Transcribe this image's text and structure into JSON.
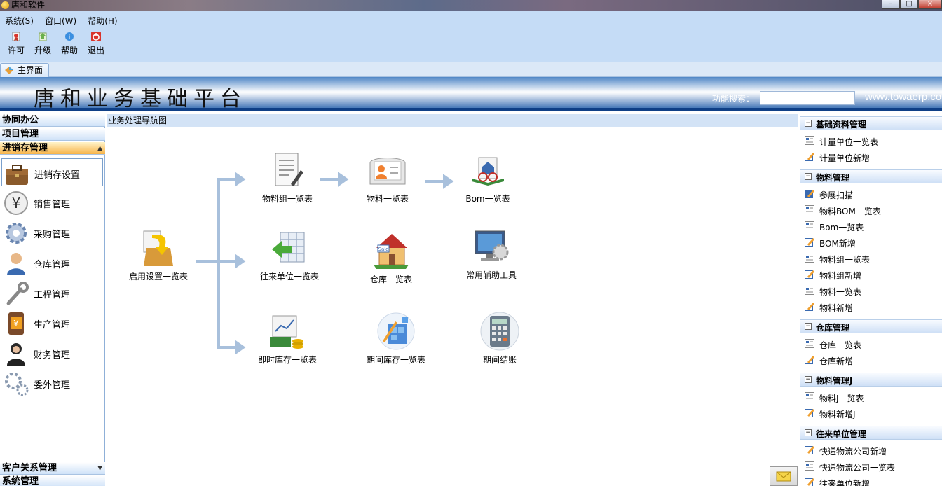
{
  "window": {
    "title": "唐和软件",
    "controls": [
      "–",
      "□",
      "×"
    ]
  },
  "menu": [
    "系统(S)",
    "窗口(W)",
    "帮助(H)"
  ],
  "toolbar": [
    {
      "label": "许可",
      "icon": "license-icon"
    },
    {
      "label": "升级",
      "icon": "upgrade-icon"
    },
    {
      "label": "帮助",
      "icon": "help-icon"
    },
    {
      "label": "退出",
      "icon": "exit-icon"
    }
  ],
  "tabs": [
    {
      "label": "主界面"
    }
  ],
  "banner": {
    "title": "唐和业务基础平台",
    "search_label": "功能搜索：",
    "search_value": "",
    "site": "www.towaerp.com"
  },
  "sidebar": {
    "top_groups": [
      "协同办公",
      "项目管理",
      "进销存管理"
    ],
    "items": [
      {
        "label": "进销存设置",
        "icon": "briefcase-icon"
      },
      {
        "label": "销售管理",
        "icon": "yen-coin-icon"
      },
      {
        "label": "采购管理",
        "icon": "gear-icon"
      },
      {
        "label": "仓库管理",
        "icon": "user-icon"
      },
      {
        "label": "工程管理",
        "icon": "wrench-icon"
      },
      {
        "label": "生产管理",
        "icon": "phone-yen-icon"
      },
      {
        "label": "财务管理",
        "icon": "woman-icon"
      },
      {
        "label": "委外管理",
        "icon": "gears-icon"
      }
    ],
    "bottom_groups": [
      "客户关系管理",
      "系统管理"
    ]
  },
  "nav": {
    "header": "业务处理导航图",
    "start": {
      "label": "启用设置一览表",
      "icon": "box-arrow-icon"
    },
    "rows": [
      [
        {
          "label": "物料组一览表",
          "icon": "document-pen-icon"
        },
        {
          "label": "物料一览表",
          "icon": "contact-card-icon"
        },
        {
          "label": "Bom一览表",
          "icon": "house-book-icon"
        }
      ],
      [
        {
          "label": "往来单位一览表",
          "icon": "sheet-arrow-icon"
        },
        {
          "label": "仓库一览表",
          "icon": "house-sale-icon"
        },
        {
          "label": "常用辅助工具",
          "icon": "monitor-gear-icon"
        }
      ],
      [
        {
          "label": "即时库存一览表",
          "icon": "chart-coins-icon"
        },
        {
          "label": "期间库存一览表",
          "icon": "blocks-icon"
        },
        {
          "label": "期间结账",
          "icon": "calculator-icon"
        }
      ]
    ]
  },
  "right_panel": {
    "groups": [
      {
        "title": "基础资料管理",
        "items": [
          {
            "label": "计量单位一览表",
            "icon": "list-icon"
          },
          {
            "label": "计量单位新增",
            "icon": "edit-icon"
          }
        ]
      },
      {
        "title": "物料管理",
        "items": [
          {
            "label": "参展扫描",
            "icon": "edit-icon"
          },
          {
            "label": "物料BOM一览表",
            "icon": "list-icon"
          },
          {
            "label": "Bom一览表",
            "icon": "list-icon"
          },
          {
            "label": "BOM新增",
            "icon": "edit-icon"
          },
          {
            "label": "物料组一览表",
            "icon": "list-icon"
          },
          {
            "label": "物料组新增",
            "icon": "edit-icon"
          },
          {
            "label": "物料一览表",
            "icon": "list-icon"
          },
          {
            "label": "物料新增",
            "icon": "edit-icon"
          }
        ]
      },
      {
        "title": "仓库管理",
        "items": [
          {
            "label": "仓库一览表",
            "icon": "list-icon"
          },
          {
            "label": "仓库新增",
            "icon": "edit-icon"
          }
        ]
      },
      {
        "title": "物料管理J",
        "items": [
          {
            "label": "物料J一览表",
            "icon": "list-icon"
          },
          {
            "label": "物料新增J",
            "icon": "edit-icon"
          }
        ]
      },
      {
        "title": "往来单位管理",
        "items": [
          {
            "label": "快递物流公司新增",
            "icon": "edit-icon"
          },
          {
            "label": "快递物流公司一览表",
            "icon": "list-icon"
          },
          {
            "label": "往来单位新增",
            "icon": "edit-icon"
          }
        ]
      }
    ]
  },
  "colors": {
    "band": "#c5dcf6",
    "banner_blue": "#2a63ad",
    "active_group": "#f7b44a",
    "arrow": "#a8c0dc"
  }
}
